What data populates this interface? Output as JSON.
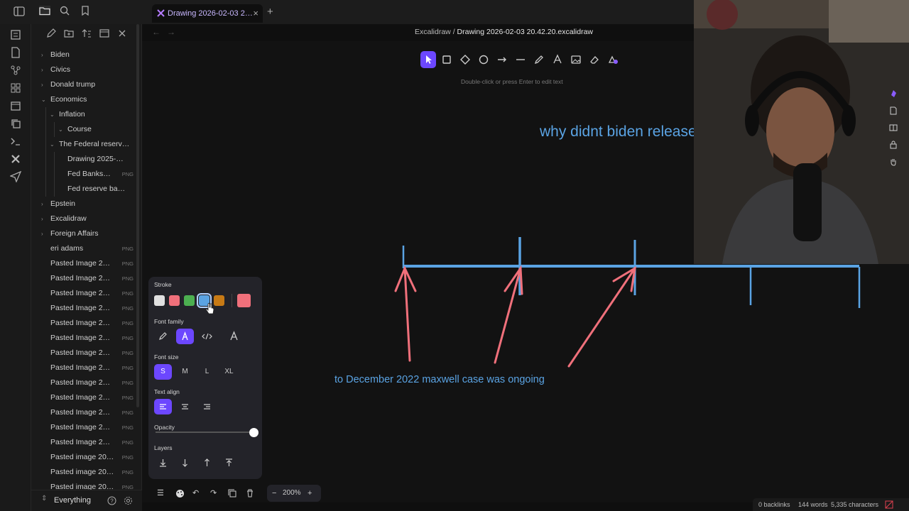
{
  "tab": {
    "title": "Drawing 2026-02-03 2…",
    "close": "×",
    "new": "+"
  },
  "breadcrumb": {
    "vault": "Excalidraw",
    "sep": " / ",
    "file": "Drawing 2026-02-03 20.42.20.excalidraw"
  },
  "sidebar": {
    "items": [
      {
        "label": "Biden",
        "depth": 0,
        "chevron": "›"
      },
      {
        "label": "Civics",
        "depth": 0,
        "chevron": "›"
      },
      {
        "label": "Donald trump",
        "depth": 0,
        "chevron": "›"
      },
      {
        "label": "Economics",
        "depth": 0,
        "chevron": "⌄"
      },
      {
        "label": "Inflation",
        "depth": 1,
        "chevron": "⌄"
      },
      {
        "label": "Course",
        "depth": 2,
        "chevron": "⌄"
      },
      {
        "label": "The Federal reserv…",
        "depth": 1,
        "chevron": "⌄"
      },
      {
        "label": "Drawing 2025-…",
        "depth": 2,
        "chevron": ""
      },
      {
        "label": "Fed Banks…",
        "depth": 2,
        "chevron": "",
        "ext": "PNG"
      },
      {
        "label": "Fed reserve ba…",
        "depth": 2,
        "chevron": ""
      },
      {
        "label": "Epstein",
        "depth": 0,
        "chevron": "›"
      },
      {
        "label": "Excalidraw",
        "depth": 0,
        "chevron": "›"
      },
      {
        "label": "Foreign Affairs",
        "depth": 0,
        "chevron": "›"
      },
      {
        "label": "eri adams",
        "depth": 0,
        "chevron": "",
        "ext": "PNG"
      },
      {
        "label": "Pasted Image 2…",
        "depth": 0,
        "chevron": "",
        "ext": "PNG"
      },
      {
        "label": "Pasted Image 2…",
        "depth": 0,
        "chevron": "",
        "ext": "PNG"
      },
      {
        "label": "Pasted Image 2…",
        "depth": 0,
        "chevron": "",
        "ext": "PNG"
      },
      {
        "label": "Pasted Image 2…",
        "depth": 0,
        "chevron": "",
        "ext": "PNG"
      },
      {
        "label": "Pasted Image 2…",
        "depth": 0,
        "chevron": "",
        "ext": "PNG"
      },
      {
        "label": "Pasted Image 2…",
        "depth": 0,
        "chevron": "",
        "ext": "PNG"
      },
      {
        "label": "Pasted Image 2…",
        "depth": 0,
        "chevron": "",
        "ext": "PNG"
      },
      {
        "label": "Pasted Image 2…",
        "depth": 0,
        "chevron": "",
        "ext": "PNG"
      },
      {
        "label": "Pasted Image 2…",
        "depth": 0,
        "chevron": "",
        "ext": "PNG"
      },
      {
        "label": "Pasted Image 2…",
        "depth": 0,
        "chevron": "",
        "ext": "PNG"
      },
      {
        "label": "Pasted Image 2…",
        "depth": 0,
        "chevron": "",
        "ext": "PNG"
      },
      {
        "label": "Pasted Image 2…",
        "depth": 0,
        "chevron": "",
        "ext": "PNG"
      },
      {
        "label": "Pasted Image 2…",
        "depth": 0,
        "chevron": "",
        "ext": "PNG"
      },
      {
        "label": "Pasted image 20…",
        "depth": 0,
        "chevron": "",
        "ext": "PNG"
      },
      {
        "label": "Pasted image 20…",
        "depth": 0,
        "chevron": "",
        "ext": "PNG"
      },
      {
        "label": "Pasted image 20…",
        "depth": 0,
        "chevron": "",
        "ext": "PNG"
      }
    ],
    "footer": {
      "vault_name": "Everything"
    }
  },
  "canvas": {
    "hint": "Double-click or press Enter to edit text",
    "heading_text": "why didnt biden release da",
    "timeline_text": "to December 2022 maxwell case was ongoing",
    "colors": {
      "text_blue": "#5aa3e3",
      "arrow_red": "#f0707b",
      "accent": "#6c47ff"
    }
  },
  "props": {
    "stroke_label": "Stroke",
    "stroke_colors": [
      "#e0e0e0",
      "#f0707b",
      "#4caf50",
      "#5aa3e3",
      "#c77a15"
    ],
    "current_stroke": "#f0707b",
    "font_family_label": "Font family",
    "font_size_label": "Font size",
    "sizes": [
      "S",
      "M",
      "L",
      "XL"
    ],
    "text_align_label": "Text align",
    "opacity_label": "Opacity",
    "layers_label": "Layers"
  },
  "zoom": {
    "value": "200%",
    "minus": "−",
    "plus": "+"
  },
  "status": {
    "backlinks": "0 backlinks",
    "words": "144 words",
    "chars": "5,335 characters"
  }
}
